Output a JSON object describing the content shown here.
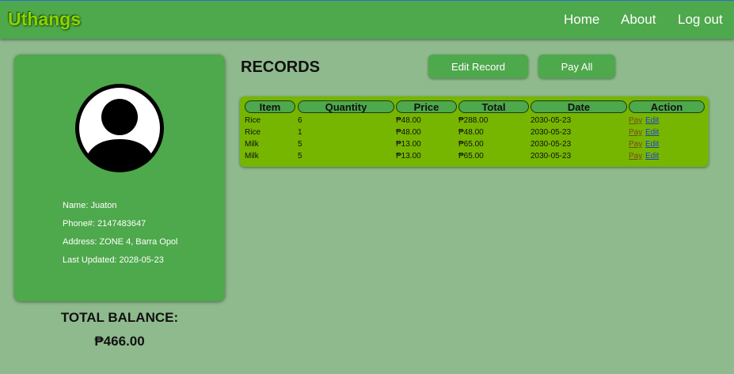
{
  "navbar": {
    "brand": "Uthangs",
    "links": [
      "Home",
      "About",
      "Log out"
    ]
  },
  "profile": {
    "avatar_icon": "user-avatar-icon",
    "name": "Name: Juaton",
    "phone": "Phone#: 2147483647",
    "address": "Address: ZONE 4, Barra Opol",
    "last_updated": "Last Updated: 2028-05-23"
  },
  "balance": {
    "title": "TOTAL BALANCE:",
    "value": "₱466.00"
  },
  "records": {
    "title": "RECORDS",
    "edit_button": "Edit Record",
    "pay_all_button": "Pay All",
    "headers": [
      "Item",
      "Quantity",
      "Price",
      "Total",
      "Date",
      "Action"
    ],
    "rows": [
      {
        "item": "Rice",
        "quantity": "6",
        "price": "₱48.00",
        "total": "₱288.00",
        "date": "2030-05-23",
        "pay": "Pay",
        "edit": "Edit"
      },
      {
        "item": "Rice",
        "quantity": "1",
        "price": "₱48.00",
        "total": "₱48.00",
        "date": "2030-05-23",
        "pay": "Pay",
        "edit": "Edit"
      },
      {
        "item": "Milk",
        "quantity": "5",
        "price": "₱13.00",
        "total": "₱65.00",
        "date": "2030-05-23",
        "pay": "Pay",
        "edit": "Edit"
      },
      {
        "item": "Milk",
        "quantity": "5",
        "price": "₱13.00",
        "total": "₱65.00",
        "date": "2030-05-23",
        "pay": "Pay",
        "edit": "Edit"
      }
    ]
  },
  "colors": {
    "page_bg": "#8fba8d",
    "navbar_bg": "#4ea84c",
    "brand": "#8ad400",
    "table_bg": "#76b600",
    "pay_link": "#7a4a1c",
    "edit_link": "#1a3fcf"
  }
}
